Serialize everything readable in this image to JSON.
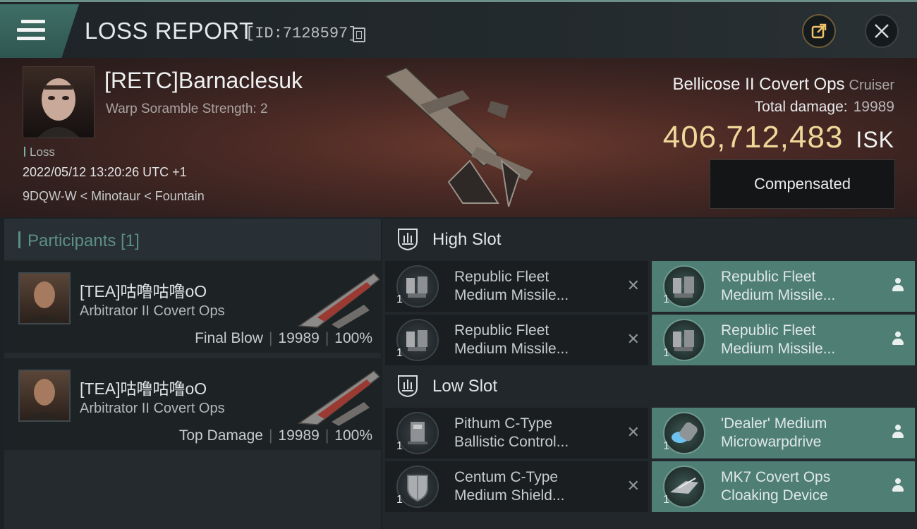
{
  "header": {
    "title": "LOSS REPORT",
    "report_id": "[ID:7128597]"
  },
  "victim": {
    "name": "[RETC]Barnaclesuk",
    "warp_scramble": "Warp Soramble Strength: 2",
    "loss_label": "Loss",
    "date": "2022/05/12 13:20:26 UTC +1",
    "location": "9DQW-W < Minotaur < Fountain",
    "ship_name": "Bellicose II Covert Ops",
    "ship_class": "Cruiser",
    "damage_label": "Total damage:",
    "damage_value": "19989",
    "isk_value": "406,712,483",
    "isk_unit": "ISK",
    "compensated_label": "Compensated"
  },
  "participants": {
    "title": "Participants [1]",
    "rows": [
      {
        "name": "[TEA]咕噜咕噜oO",
        "ship": "Arbitrator II Covert Ops",
        "role": "Final Blow",
        "damage": "19989",
        "percent": "100%"
      },
      {
        "name": "[TEA]咕噜咕噜oO",
        "ship": "Arbitrator II Covert Ops",
        "role": "Top Damage",
        "damage": "19989",
        "percent": "100%"
      }
    ]
  },
  "slots": {
    "high": {
      "title": "High Slot",
      "modules": [
        {
          "qty": "1",
          "name": "Republic Fleet\nMedium Missile...",
          "state": "destroyed",
          "icon": "missile-launcher-icon"
        },
        {
          "qty": "1",
          "name": "Republic Fleet\nMedium Missile...",
          "state": "dropped",
          "icon": "missile-launcher-icon"
        },
        {
          "qty": "1",
          "name": "Republic Fleet\nMedium Missile...",
          "state": "destroyed",
          "icon": "missile-launcher-icon"
        },
        {
          "qty": "1",
          "name": "Republic Fleet\nMedium Missile...",
          "state": "dropped",
          "icon": "missile-launcher-icon"
        }
      ]
    },
    "low": {
      "title": "Low Slot",
      "modules": [
        {
          "qty": "1",
          "name": "Pithum C-Type\nBallistic Control...",
          "state": "destroyed",
          "icon": "ballistic-control-icon"
        },
        {
          "qty": "1",
          "name": "'Dealer' Medium\nMicrowarpdrive",
          "state": "dropped",
          "icon": "microwarpdrive-icon"
        },
        {
          "qty": "1",
          "name": "Centum C-Type\nMedium Shield...",
          "state": "destroyed",
          "icon": "shield-icon"
        },
        {
          "qty": "1",
          "name": "MK7 Covert Ops\nCloaking Device",
          "state": "dropped",
          "icon": "cloaking-device-icon"
        }
      ]
    }
  },
  "colors": {
    "accent_teal": "#4f7e75",
    "isk_gold": "#f0d79a"
  }
}
